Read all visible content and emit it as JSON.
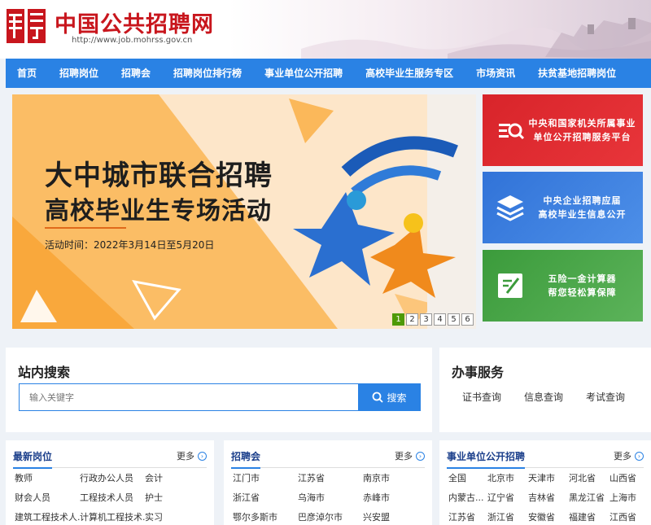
{
  "header": {
    "site_name": "中国公共招聘网",
    "site_url": "http://www.job.mohrss.gov.cn",
    "colors": {
      "brand_red": "#c8161d",
      "nav_blue": "#2a82e4"
    }
  },
  "nav": {
    "items": [
      "首页",
      "招聘岗位",
      "招聘会",
      "招聘岗位排行榜",
      "事业单位公开招聘",
      "高校毕业生服务专区",
      "市场资讯",
      "扶贫基地招聘岗位"
    ]
  },
  "banner": {
    "title_line1": "大中城市联合招聘",
    "title_line2": "高校毕业生专场活动",
    "date_text": "活动时间：2022年3月14日至5月20日",
    "pages": [
      "1",
      "2",
      "3",
      "4",
      "5",
      "6"
    ],
    "active_page": "1"
  },
  "side_cards": [
    {
      "line1": "中央和国家机关所属事业",
      "line2": "单位公开招聘服务平台",
      "icon": "search-doc-icon",
      "color": "#d8242a"
    },
    {
      "line1": "中央企业招聘应届",
      "line2": "高校毕业生信息公开",
      "icon": "layers-icon",
      "color": "#3173d8"
    },
    {
      "line1": "五险一金计算器",
      "line2": "帮您轻松算保障",
      "icon": "calculator-edit-icon",
      "color": "#3b9b3b"
    }
  ],
  "search": {
    "title": "站内搜索",
    "placeholder": "输入关键字",
    "button_label": "搜索"
  },
  "services": {
    "title": "办事服务",
    "links": [
      "证书查询",
      "信息查询",
      "考试查询"
    ]
  },
  "lists": {
    "more_label": "更多",
    "latest_jobs": {
      "title": "最新岗位",
      "items": [
        "教师",
        "行政办公人员",
        "会计",
        "财会人员",
        "工程技术人员",
        "护士",
        "建筑工程技术人...",
        "计算机工程技术...",
        "实习"
      ]
    },
    "job_fairs": {
      "title": "招聘会",
      "items": [
        "江门市",
        "江苏省",
        "南京市",
        "浙江省",
        "乌海市",
        "赤峰市",
        "鄂尔多斯市",
        "巴彦淖尔市",
        "兴安盟"
      ]
    },
    "public_institutions": {
      "title": "事业单位公开招聘",
      "items": [
        "全国",
        "北京市",
        "天津市",
        "河北省",
        "山西省",
        "内蒙古...",
        "辽宁省",
        "吉林省",
        "黑龙江省",
        "上海市",
        "江苏省",
        "浙江省",
        "安徽省",
        "福建省",
        "江西省"
      ]
    }
  }
}
